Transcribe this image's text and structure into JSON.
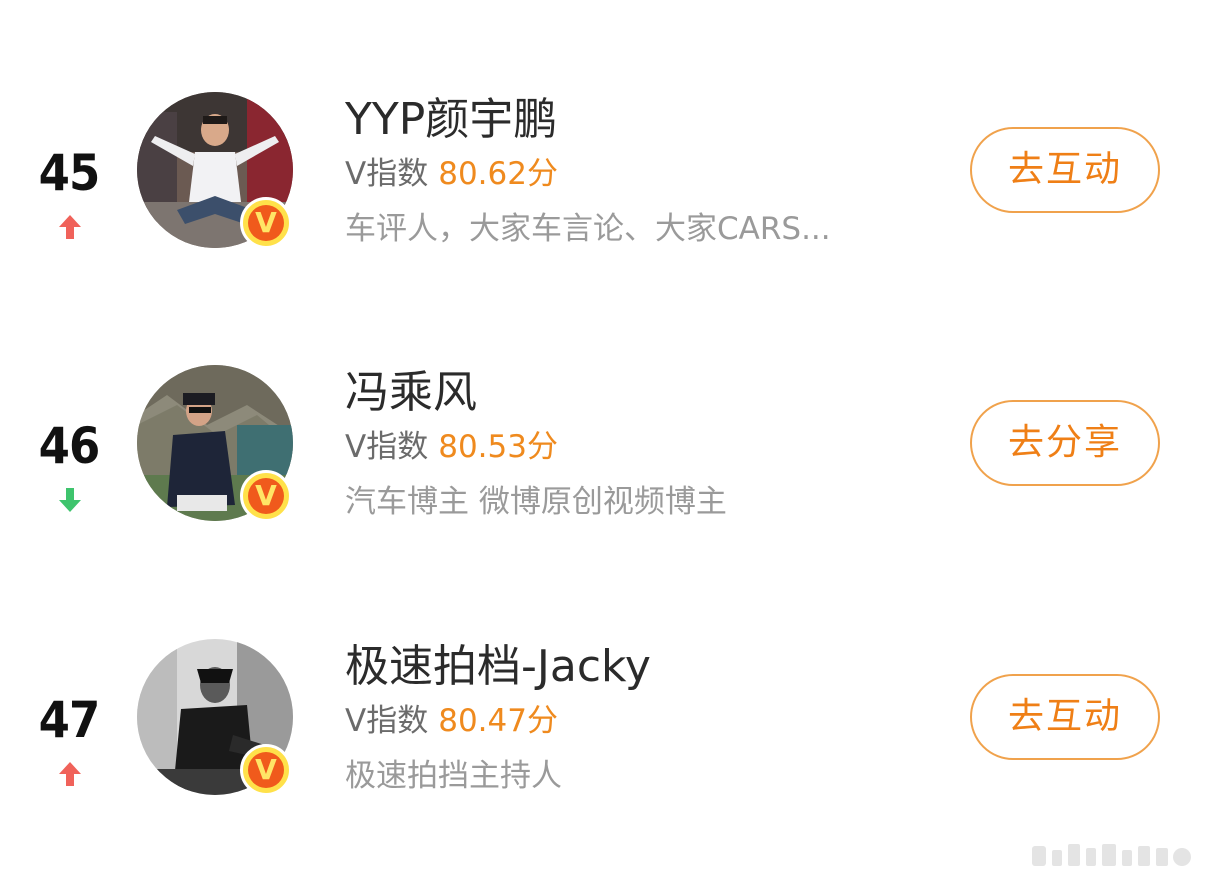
{
  "rankings": [
    {
      "rank": "45",
      "trend": "up",
      "name": "YYP颜宇鹏",
      "score_label": "V指数",
      "score_value": "80.62分",
      "description": "车评人，大家车言论、大家CARS...",
      "action_label": "去互动"
    },
    {
      "rank": "46",
      "trend": "down",
      "name": "冯乘风",
      "score_label": "V指数",
      "score_value": "80.53分",
      "description": "汽车博主 微博原创视频博主",
      "action_label": "去分享"
    },
    {
      "rank": "47",
      "trend": "up",
      "name": "极速拍档-Jacky",
      "score_label": "V指数",
      "score_value": "80.47分",
      "description": "极速拍挡主持人",
      "action_label": "去互动"
    }
  ],
  "badge": {
    "letter": "V"
  },
  "icons": {
    "trend_up": "arrow-up-icon",
    "trend_down": "arrow-down-icon",
    "verified": "verified-v-badge-icon"
  },
  "colors": {
    "accent": "#ef8a1e",
    "trend_up": "#f0625a",
    "trend_down": "#3ec46d",
    "badge_bg": "#f05a1c",
    "badge_ring": "#ffe14a"
  }
}
